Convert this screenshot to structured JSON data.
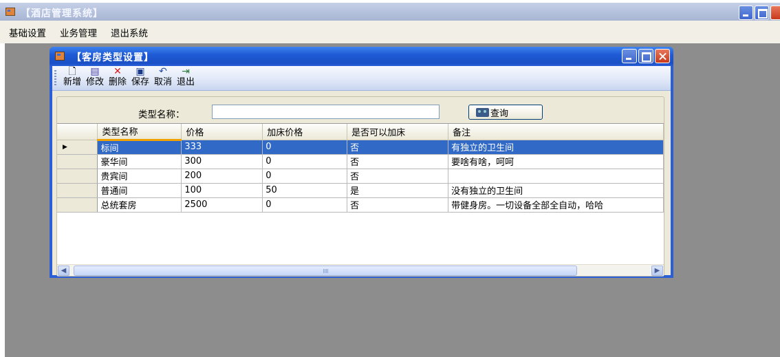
{
  "main_window": {
    "title": "【酒店管理系统】"
  },
  "menu": {
    "items": [
      "基础设置",
      "业务管理",
      "退出系统"
    ]
  },
  "child_window": {
    "title": "【客房类型设置】"
  },
  "toolbar": {
    "buttons": [
      {
        "label": "新增",
        "icon": "new-icon"
      },
      {
        "label": "修改",
        "icon": "edit-icon"
      },
      {
        "label": "删除",
        "icon": "delete-icon"
      },
      {
        "label": "保存",
        "icon": "save-icon"
      },
      {
        "label": "取消",
        "icon": "undo-icon"
      },
      {
        "label": "退出",
        "icon": "exit-icon"
      }
    ]
  },
  "search": {
    "label": "类型名称：",
    "value": "",
    "button_label": "查询",
    "button_icon": "binoculars-icon"
  },
  "grid": {
    "columns": [
      "类型名称",
      "价格",
      "加床价格",
      "是否可以加床",
      "备注"
    ],
    "current_row_marker": "▶",
    "rows": [
      [
        "标间",
        "333",
        "0",
        "否",
        "有独立的卫生间"
      ],
      [
        "豪华间",
        "300",
        "0",
        "否",
        "要啥有啥，呵呵"
      ],
      [
        "贵宾间",
        "200",
        "0",
        "否",
        ""
      ],
      [
        "普通间",
        "100",
        "50",
        "是",
        "没有独立的卫生间"
      ],
      [
        "总统套房",
        "2500",
        "0",
        "否",
        "带健身房。一切设备全部全自动，哈哈"
      ]
    ],
    "selected_row": 0
  },
  "colors": {
    "title_blue": "#1f5bd6",
    "selection": "#3169c6",
    "mdi_background": "#8d8d8d"
  }
}
